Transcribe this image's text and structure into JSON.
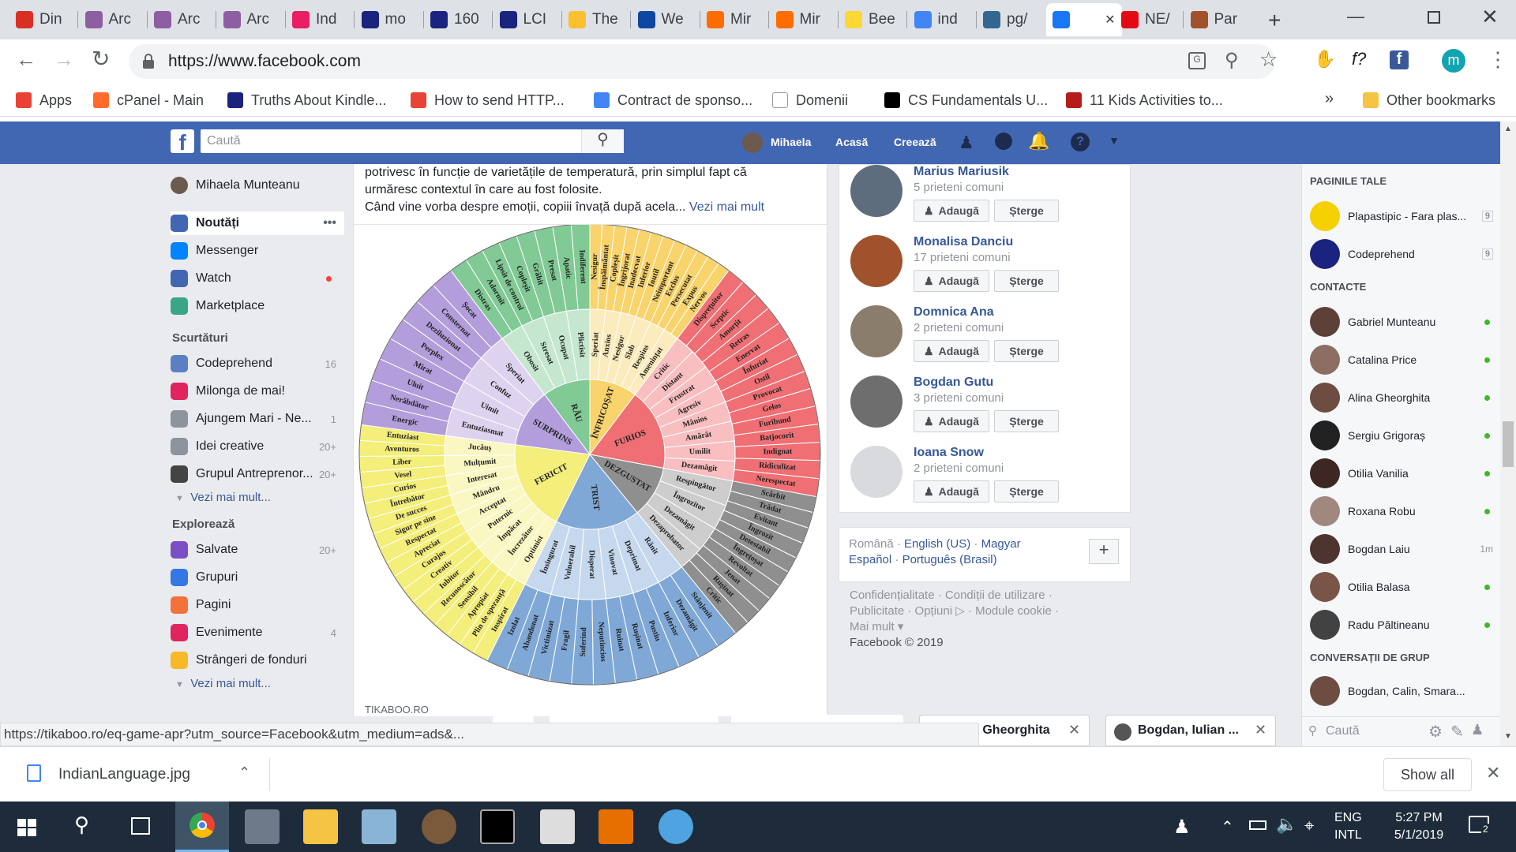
{
  "tabs": [
    {
      "label": "Din",
      "color": "#d93025"
    },
    {
      "label": "Arc",
      "color": "#8e5ea2"
    },
    {
      "label": "Arc",
      "color": "#8e5ea2"
    },
    {
      "label": "Arc",
      "color": "#8e5ea2"
    },
    {
      "label": "Ind",
      "color": "#e91e63"
    },
    {
      "label": "mo",
      "color": "#1a237e"
    },
    {
      "label": "160",
      "color": "#1a237e"
    },
    {
      "label": "LCI",
      "color": "#1a237e"
    },
    {
      "label": "The",
      "color": "#fbc02d"
    },
    {
      "label": "We",
      "color": "#0d47a1"
    },
    {
      "label": "Mir",
      "color": "#ff6d00"
    },
    {
      "label": "Mir",
      "color": "#ff6d00"
    },
    {
      "label": "Bee",
      "color": "#fdd835"
    },
    {
      "label": "ind",
      "color": "#4285f4"
    },
    {
      "label": "pg/",
      "color": "#336791"
    },
    {
      "label": "",
      "color": "#1877f2"
    },
    {
      "label": "NE/",
      "color": "#e50914"
    },
    {
      "label": "Par",
      "color": "#a0522d"
    }
  ],
  "address": {
    "url": "https://www.facebook.com",
    "profile_initial": "m",
    "f_label": "f?"
  },
  "bookmarks": [
    {
      "label": "Apps"
    },
    {
      "label": "cPanel - Main"
    },
    {
      "label": "Truths About Kindle..."
    },
    {
      "label": "How to send HTTP..."
    },
    {
      "label": "Contract de sponso..."
    },
    {
      "label": "Domenii"
    },
    {
      "label": "CS Fundamentals U..."
    },
    {
      "label": "11 Kids Activities to..."
    }
  ],
  "bookmarks_more": "»",
  "other_bookmarks": "Other bookmarks",
  "fb": {
    "search_placeholder": "Caută",
    "user": "Mihaela",
    "home": "Acasă",
    "create": "Creează"
  },
  "leftnav": {
    "profile": "Mihaela Munteanu",
    "main": [
      {
        "label": "Noutăți"
      },
      {
        "label": "Messenger"
      },
      {
        "label": "Watch"
      },
      {
        "label": "Marketplace"
      }
    ],
    "shortcuts_title": "Scurtături",
    "shortcuts": [
      {
        "label": "Codeprehend",
        "count": "16"
      },
      {
        "label": "Milonga de mai!",
        "count": ""
      },
      {
        "label": "Ajungem Mari - Ne...",
        "count": "1"
      },
      {
        "label": "Idei creative",
        "count": "20+"
      },
      {
        "label": "Grupul Antreprenor...",
        "count": "20+"
      }
    ],
    "more": "Vezi mai mult...",
    "explore_title": "Explorează",
    "explore": [
      {
        "label": "Salvate",
        "count": "20+"
      },
      {
        "label": "Grupuri",
        "count": ""
      },
      {
        "label": "Pagini",
        "count": ""
      },
      {
        "label": "Evenimente",
        "count": "4"
      },
      {
        "label": "Strângeri de fonduri",
        "count": ""
      }
    ],
    "more2": "Vezi mai mult..."
  },
  "post": {
    "line1": "potrivesc în funcție de varietățile de temperatură, prin simplul fapt că",
    "line2": "urmăresc contextul în care au fost folosite.",
    "line3": "Când vine vorba despre emoții, copiii învață după acela...",
    "see_more": "Vezi mai mult",
    "source": "TIKABOO.RO"
  },
  "wheel": {
    "inner": [
      {
        "label": "ÎNFRICOȘAT",
        "color": "#f9d36b"
      },
      {
        "label": "FURIOS",
        "color": "#ef6f74"
      },
      {
        "label": "DEZGUSTAT",
        "color": "#8f8f8f"
      },
      {
        "label": "TRIST",
        "color": "#7fa8d6"
      },
      {
        "label": "FERICIT",
        "color": "#f4ee7a"
      },
      {
        "label": "SURPRINS",
        "color": "#b39ddb"
      },
      {
        "label": "RĂU",
        "color": "#81c995"
      }
    ],
    "middle": [
      [
        "Speriat",
        "Anxios",
        "Nesigur",
        "Slab",
        "Respins",
        "Amenințat"
      ],
      [
        "Critic",
        "Distant",
        "Frustrat",
        "Agresiv",
        "Mânios",
        "Amărât",
        "Umilit",
        "Dezamăgit"
      ],
      [
        "Respingător",
        "Îngrozitor",
        "Dezamăgit",
        "Dezaprobator"
      ],
      [
        "Rănit",
        "Deprimat",
        "Vinovat",
        "Disperat",
        "Vulnerabil",
        "Însingurat"
      ],
      [
        "Optimist",
        "Încrezător",
        "Împăcat",
        "Puternic",
        "Acceptat",
        "Mândru",
        "Interesat",
        "Mulțumit",
        "Jucăuș"
      ],
      [
        "Entuziasmat",
        "Uimit",
        "Confuz",
        "Speriat"
      ],
      [
        "Obosit",
        "Stresat",
        "Ocupat",
        "Plictisit"
      ]
    ],
    "outer": [
      [
        "Nesigur",
        "Înspăimântat",
        "Copleșit",
        "Îngrijorat",
        "Inadecvat",
        "Inferior",
        "Inutil",
        "Neimportant",
        "Exclus",
        "Persecutat",
        "Expus",
        "Nervos"
      ],
      [
        "Disprețuitor",
        "Sceptic",
        "Amorțit",
        "Retras",
        "Enervat",
        "Înfuriat",
        "Ostil",
        "Provocat",
        "Gelos",
        "Furibund",
        "Batjocorit",
        "Indignat",
        "Ridiculizat",
        "Nerespectat"
      ],
      [
        "Scârbit",
        "Trădat",
        "Evitant",
        "Îngrozit",
        "Detestabil",
        "Îngrețoșat",
        "Revoltat",
        "Jenat",
        "Rușinat",
        "Critic"
      ],
      [
        "Stânjenit",
        "Dezamăgit",
        "Inferior",
        "Pustiu",
        "Rușinat",
        "Ruinat",
        "Neputincios",
        "Suferind",
        "Fragil",
        "Victimizat",
        "Abandonat",
        "Izolat"
      ],
      [
        "Inspirat",
        "Plin de speranță",
        "Apropiat",
        "Sensibil",
        "Recunoscător",
        "Iubitor",
        "Creativ",
        "Curajos",
        "Apreciat",
        "Respectat",
        "Sigur pe sine",
        "De succes",
        "Întrebător",
        "Curios",
        "Vesel",
        "Liber",
        "Aventuros",
        "Entuziast"
      ],
      [
        "Energic",
        "Nerăbdător",
        "Uluit",
        "Mirat",
        "Perplex",
        "Deziluzionat",
        "Consternat",
        "Șocat"
      ],
      [
        "Distras",
        "Adormit",
        "Lipsit de control",
        "Copleșit",
        "Grăbit",
        "Presat",
        "Apatic",
        "Indiferent"
      ]
    ]
  },
  "people": [
    {
      "name": "Marius Mariusik",
      "mutual": "5 prieteni comuni"
    },
    {
      "name": "Monalisa Danciu",
      "mutual": "17 prieteni comuni"
    },
    {
      "name": "Domnica Ana",
      "mutual": "2 prieteni comuni"
    },
    {
      "name": "Bogdan Gutu",
      "mutual": "3 prieteni comuni"
    },
    {
      "name": "Ioana Snow",
      "mutual": "2 prieteni comuni"
    }
  ],
  "add_label": "Adaugă",
  "remove_label": "Șterge",
  "langs": {
    "line1a": "Română",
    "line1b": "English (US)",
    "line1c": "Magyar",
    "line2a": "Español",
    "line2b": "Português (Brasil)"
  },
  "footer": {
    "l1": "Confidențialitate · Condiții de utilizare ·",
    "l2": "Publicitate · Opțiuni ▷ · Module cookie ·",
    "l3": "Mai mult ▾",
    "l4": "Facebook © 2019"
  },
  "chat": {
    "pages_title": "PAGINILE TALE",
    "pages": [
      {
        "label": "Plapastipic - Fara plas...",
        "count": "9"
      },
      {
        "label": "Codeprehend",
        "count": "9"
      }
    ],
    "contacts_title": "CONTACTE",
    "contacts": [
      {
        "name": "Gabriel Munteanu",
        "status": "online"
      },
      {
        "name": "Catalina Price",
        "status": "online"
      },
      {
        "name": "Alina Gheorghita",
        "status": "online"
      },
      {
        "name": "Sergiu Grigoraș",
        "status": "online"
      },
      {
        "name": "Otilia Vanilia",
        "status": "online"
      },
      {
        "name": "Roxana Robu",
        "status": "online"
      },
      {
        "name": "Bogdan Laiu",
        "status": "1m"
      },
      {
        "name": "Otilia Balasa",
        "status": "online"
      },
      {
        "name": "Radu Păltineanu",
        "status": "online"
      }
    ],
    "groups_title": "CONVERSAȚII DE GRUP",
    "groups": [
      {
        "name": "Bogdan, Calin, Smara..."
      }
    ],
    "search_placeholder": "Caută"
  },
  "chat_tabs": [
    {
      "label": "a Gheorghita"
    },
    {
      "label": "Bogdan, Iulian ..."
    }
  ],
  "status_url": "https://tikaboo.ro/eq-game-apr?utm_source=Facebook&utm_medium=ads&...",
  "download": {
    "file": "IndianLanguage.jpg",
    "show_all": "Show all"
  },
  "taskbar": {
    "lang1": "ENG",
    "lang2": "INTL",
    "time": "5:27 PM",
    "date": "5/1/2019",
    "notif": "2"
  }
}
